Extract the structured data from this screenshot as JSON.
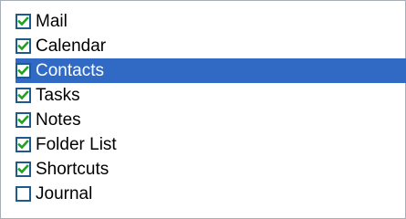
{
  "list": {
    "items": [
      {
        "label": "Mail",
        "checked": true,
        "selected": false
      },
      {
        "label": "Calendar",
        "checked": true,
        "selected": false
      },
      {
        "label": "Contacts",
        "checked": true,
        "selected": true
      },
      {
        "label": "Tasks",
        "checked": true,
        "selected": false
      },
      {
        "label": "Notes",
        "checked": true,
        "selected": false
      },
      {
        "label": "Folder List",
        "checked": true,
        "selected": false
      },
      {
        "label": "Shortcuts",
        "checked": true,
        "selected": false
      },
      {
        "label": "Journal",
        "checked": false,
        "selected": false
      }
    ]
  },
  "colors": {
    "selection": "#316ac5",
    "checkmark": "#21a121",
    "checkbox_border": "#1e5a8c"
  }
}
